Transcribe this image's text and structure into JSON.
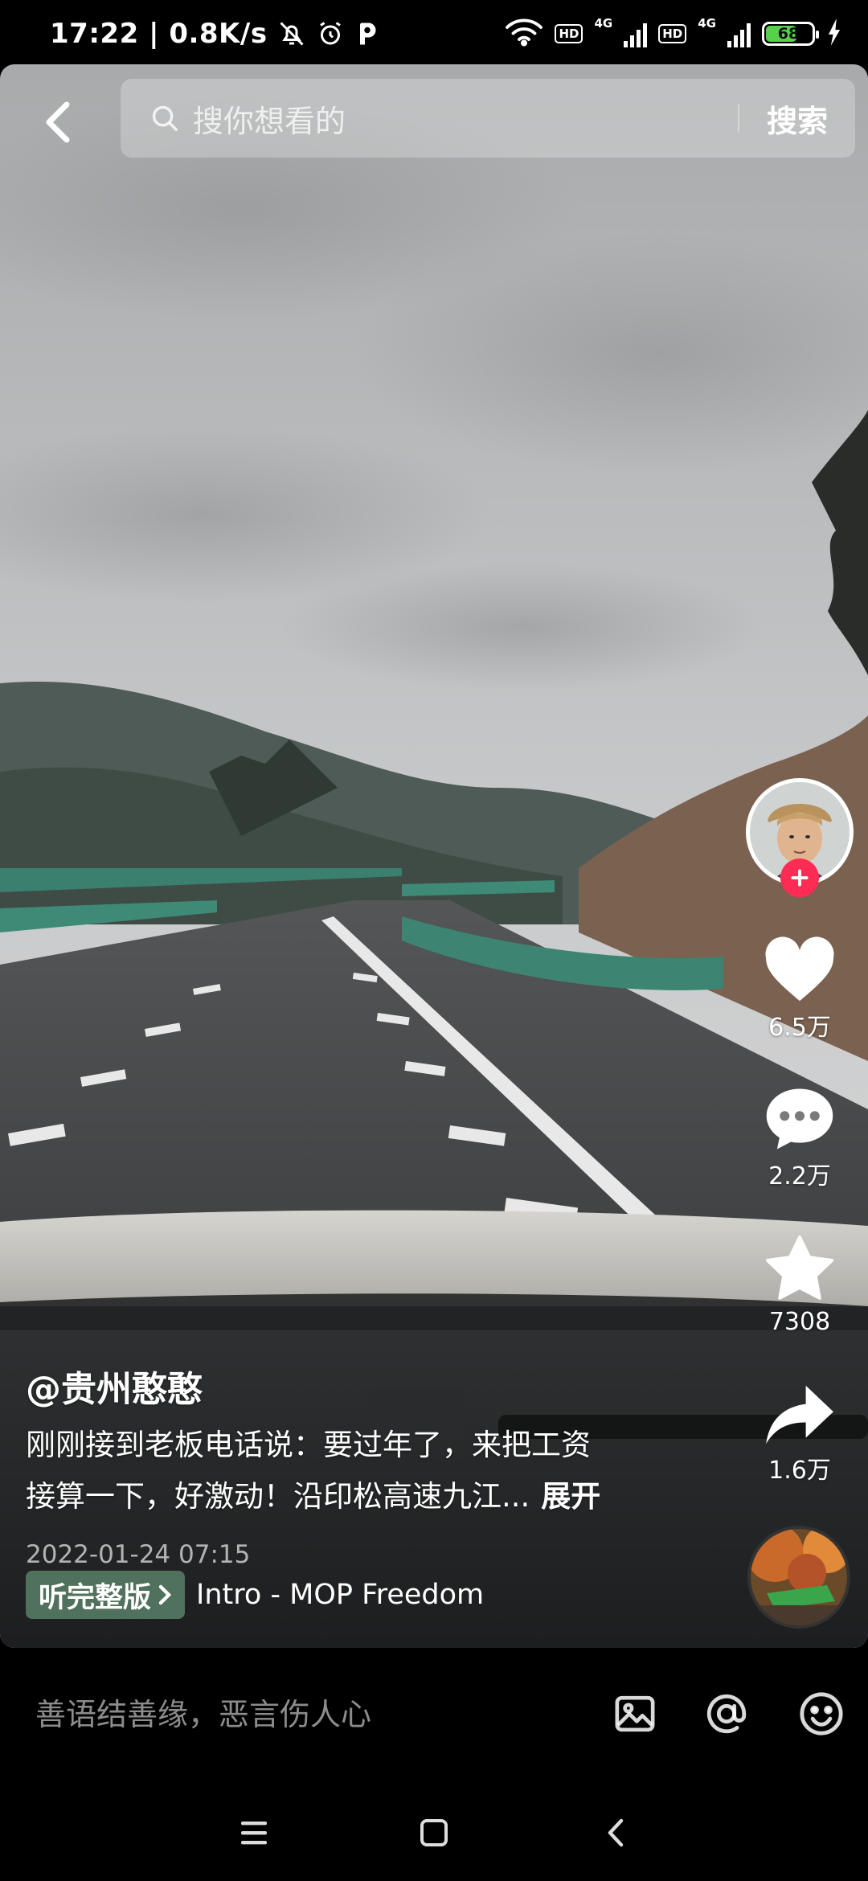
{
  "status_bar": {
    "time_speed": "17:22 | 0.8K/s",
    "network_hd1": "HD",
    "network_4g1": "4G",
    "network_hd2": "HD",
    "network_4g2": "4G",
    "battery_level": "68",
    "battery_fraction": 0.68
  },
  "header": {
    "search_placeholder": "搜你想看的",
    "search_button": "搜索"
  },
  "actions": {
    "likes": "6.5万",
    "comments": "2.2万",
    "favorites": "7308",
    "shares": "1.6万"
  },
  "post": {
    "author": "@贵州憨憨",
    "caption_line1": "刚刚接到老板电话说：要过年了，来把工资",
    "caption_line2": "接算一下，好激动！沿印松高速九江...",
    "expand_label": "展开",
    "date": "2022-01-24 07:15"
  },
  "music": {
    "listen_full": "听完整版",
    "title": "Intro - MOP Freedom"
  },
  "comment_bar": {
    "placeholder": "善语结善缘，恶言伤人心"
  },
  "colors": {
    "accent": "#fe2c55",
    "battery": "#57d14b"
  }
}
